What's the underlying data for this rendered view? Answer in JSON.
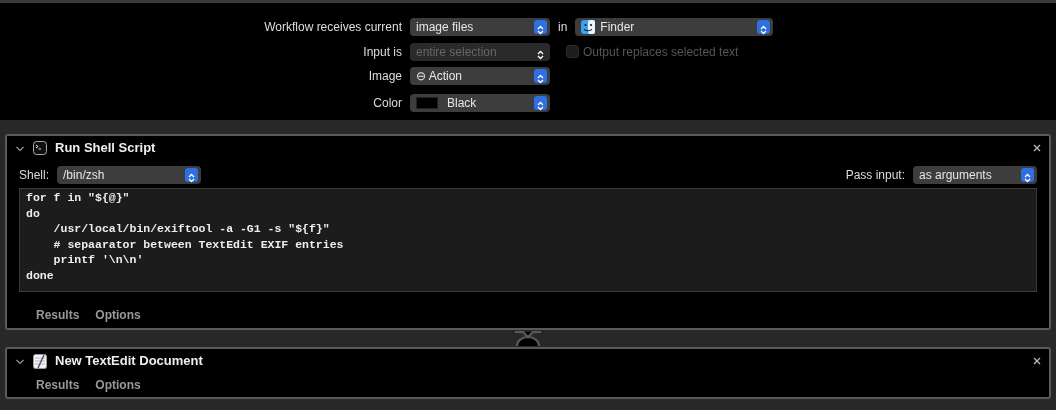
{
  "workflow": {
    "receives_label": "Workflow receives current",
    "receives_value": "image files",
    "in_label": "in",
    "application": "Finder",
    "input_label": "Input is",
    "input_value": "entire selection",
    "input_disabled": true,
    "output_checkbox": {
      "label": "Output replaces selected text",
      "checked": false,
      "disabled": true
    },
    "image_label": "Image",
    "image_glyph": "⊖",
    "image_value": "Action",
    "color_label": "Color",
    "color_value": "Black"
  },
  "actions": [
    {
      "kind": "shell",
      "title": "Run Shell Script",
      "expanded": true,
      "shell_label": "Shell:",
      "shell_value": "/bin/zsh",
      "pass_label": "Pass input:",
      "pass_value": "as arguments",
      "code": [
        "for f in \"${@}\"",
        "do",
        "    /usr/local/bin/exiftool -a -G1 -s \"${f}\"",
        "    # sepaarator between TextEdit EXIF entries",
        "    printf '\\n\\n'",
        "done"
      ],
      "tabs": [
        "Results",
        "Options"
      ]
    },
    {
      "kind": "textedit",
      "title": "New TextEdit Document",
      "expanded": true,
      "tabs": [
        "Results",
        "Options"
      ]
    }
  ]
}
